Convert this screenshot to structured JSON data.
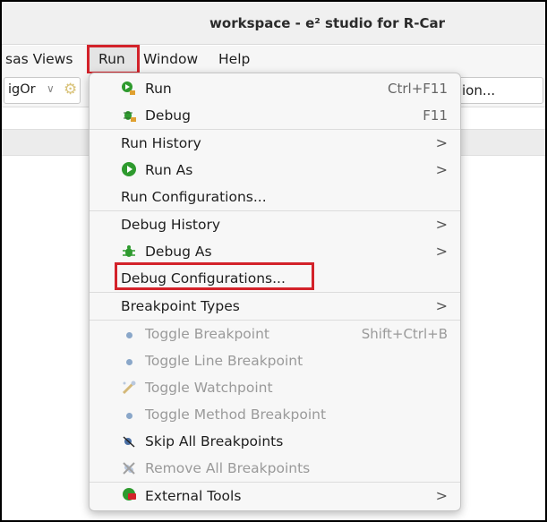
{
  "window": {
    "title": "workspace - e² studio for R-Car"
  },
  "menubar": {
    "items": [
      {
        "label": "sas Views"
      },
      {
        "label": "Run"
      },
      {
        "label": "Window"
      },
      {
        "label": "Help"
      }
    ]
  },
  "toolbar": {
    "config_combo_value": "igOr",
    "search_value": "ion..."
  },
  "run_menu": {
    "items": [
      {
        "label": "Run",
        "accelerator": "Ctrl+F11",
        "icon": "run-icon"
      },
      {
        "label": "Debug",
        "accelerator": "F11",
        "icon": "debug-icon"
      },
      {
        "label": "Run History",
        "submenu_arrow": ">"
      },
      {
        "label": "Run As",
        "submenu_arrow": ">",
        "icon": "run-as-icon"
      },
      {
        "label": "Run Configurations..."
      },
      {
        "label": "Debug History",
        "submenu_arrow": ">"
      },
      {
        "label": "Debug As",
        "submenu_arrow": ">",
        "icon": "bug-icon"
      },
      {
        "label": "Debug Configurations..."
      },
      {
        "label": "Breakpoint Types",
        "submenu_arrow": ">"
      },
      {
        "label": "Toggle Breakpoint",
        "accelerator": "Shift+Ctrl+B",
        "icon": "breakpoint-dot-icon",
        "enabled": false
      },
      {
        "label": "Toggle Line Breakpoint",
        "icon": "breakpoint-dot-icon",
        "enabled": false
      },
      {
        "label": "Toggle Watchpoint",
        "icon": "watchpoint-icon",
        "enabled": false
      },
      {
        "label": "Toggle Method Breakpoint",
        "icon": "breakpoint-dot-icon",
        "enabled": false
      },
      {
        "label": "Skip All Breakpoints",
        "icon": "skip-breakpoints-icon"
      },
      {
        "label": "Remove All Breakpoints",
        "icon": "remove-breakpoints-icon",
        "enabled": false
      },
      {
        "label": "External Tools",
        "submenu_arrow": ">",
        "icon": "external-tools-icon"
      }
    ]
  },
  "colors": {
    "highlight_red": "#d3222a",
    "run_green": "#2e9a2e",
    "disabled_text": "#9a9a9a"
  }
}
